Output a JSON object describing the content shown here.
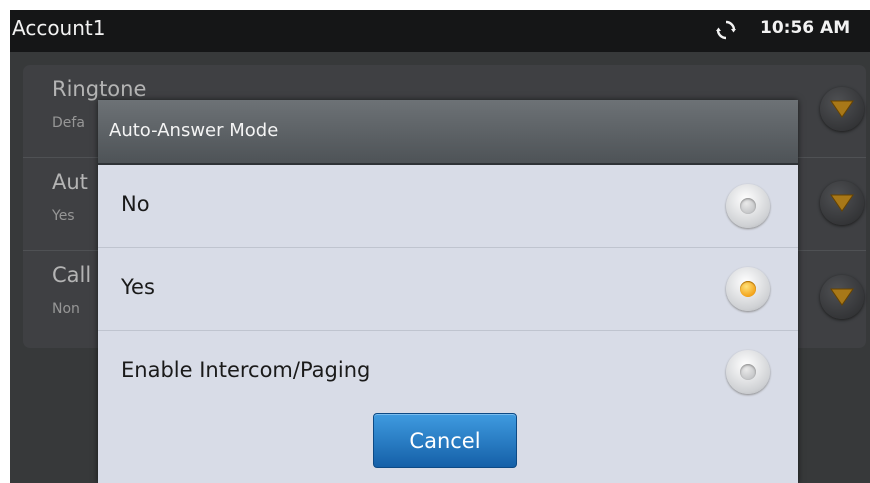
{
  "statusbar": {
    "title": "Account1",
    "time": "10:56 AM",
    "sync_icon": "sync-icon"
  },
  "settings": {
    "items": [
      {
        "title": "Ringtone",
        "subtitle": "Defa"
      },
      {
        "title": "Aut",
        "subtitle": "Yes"
      },
      {
        "title": "Call",
        "subtitle": "Non"
      }
    ]
  },
  "dialog": {
    "title": "Auto-Answer Mode",
    "options": [
      {
        "label": "No",
        "selected": false
      },
      {
        "label": "Yes",
        "selected": true
      },
      {
        "label": "Enable Intercom/Paging",
        "selected": false
      }
    ],
    "cancel_label": "Cancel"
  },
  "colors": {
    "accent_radio": "#f3a31a",
    "button_blue": "#1f6fb8",
    "dropdown_arrow": "#e0a020"
  }
}
